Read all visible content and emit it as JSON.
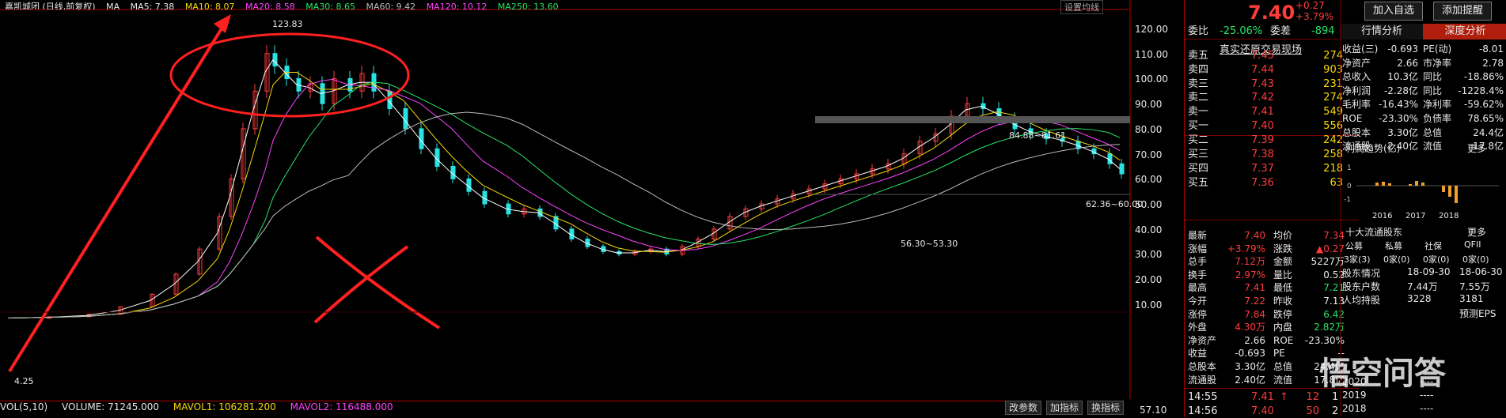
{
  "chart_legend": {
    "title": "嘉凯城团 (日线,前复权)",
    "ma_label": "MA",
    "ma5": "MA5: 7.38",
    "ma10": "MA10: 8.07",
    "ma20": "MA20: 8.58",
    "ma30": "MA30: 8.65",
    "ma60": "MA60: 9.42",
    "ma120": "MA120: 10.12",
    "ma250": "MA250: 13.60"
  },
  "chart_tag": "设置均线",
  "y_axis": [
    "120.00",
    "110.00",
    "100.00",
    "90.00",
    "80.00",
    "70.00",
    "60.00",
    "50.00",
    "40.00",
    "30.00",
    "20.00",
    "10.00"
  ],
  "price_annotations": {
    "high": "123.83",
    "low": "4.25",
    "band1": "84.88~81.61",
    "band2": "62.36~60.00",
    "band3": "56.30~53.30"
  },
  "vol_legend": {
    "vol": "VOL(5,10)",
    "volume": "VOLUME: 71245.000",
    "mavol1": "MAVOL1: 106281.200",
    "mavol2": "MAVOL2: 116488.000"
  },
  "vol_buttons": [
    "改参数",
    "加指标",
    "换指标"
  ],
  "vol_axis": "57.10",
  "quote": {
    "price": "7.40",
    "change": "+0.27",
    "pct": "+3.79%",
    "weibi_label": "委比",
    "weibi": "-25.06%",
    "weicha_label": "委差",
    "weicha": "-894",
    "replay": "真实还原交易现场",
    "asks": [
      {
        "label": "卖五",
        "price": "7.45",
        "vol": "274"
      },
      {
        "label": "卖四",
        "price": "7.44",
        "vol": "903"
      },
      {
        "label": "卖三",
        "price": "7.43",
        "vol": "231"
      },
      {
        "label": "卖二",
        "price": "7.42",
        "vol": "274"
      },
      {
        "label": "卖一",
        "price": "7.41",
        "vol": "549"
      }
    ],
    "bids": [
      {
        "label": "买一",
        "price": "7.40",
        "vol": "556"
      },
      {
        "label": "买二",
        "price": "7.39",
        "vol": "242"
      },
      {
        "label": "买三",
        "price": "7.38",
        "vol": "258"
      },
      {
        "label": "买四",
        "price": "7.37",
        "vol": "218"
      },
      {
        "label": "买五",
        "price": "7.36",
        "vol": "63"
      }
    ],
    "stats": [
      {
        "l1": "最新",
        "v1": "7.40",
        "l2": "均价",
        "v2": "7.34"
      },
      {
        "l1": "涨幅",
        "v1": "+3.79%",
        "l2": "涨跌",
        "v2": "▲0.27"
      },
      {
        "l1": "总手",
        "v1": "7.12万",
        "l2": "金额",
        "v2": "5227万"
      },
      {
        "l1": "换手",
        "v1": "2.97%",
        "l2": "量比",
        "v2": "0.52"
      },
      {
        "l1": "最高",
        "v1": "7.41",
        "l2": "最低",
        "v2": "7.21"
      },
      {
        "l1": "今开",
        "v1": "7.22",
        "l2": "昨收",
        "v2": "7.13"
      },
      {
        "l1": "涨停",
        "v1": "7.84",
        "l2": "跌停",
        "v2": "6.42"
      },
      {
        "l1": "外盘",
        "v1": "4.30万",
        "l2": "内盘",
        "v2": "2.82万"
      },
      {
        "l1": "净资产",
        "v1": "2.66",
        "l2": "ROE",
        "v2": "-23.30%"
      },
      {
        "l1": "收益",
        "v1": "-0.693",
        "l2": "PE",
        "v2": "--"
      },
      {
        "l1": "总股本",
        "v1": "3.30亿",
        "l2": "总值",
        "v2": "24.4亿"
      },
      {
        "l1": "流通股",
        "v1": "2.40亿",
        "l2": "流值",
        "v2": "17.8亿"
      }
    ],
    "ticks": [
      {
        "time": "14:55",
        "price": "7.41",
        "arrow": "↑",
        "vol": "12",
        "flag": "1"
      },
      {
        "time": "14:56",
        "price": "7.40",
        "arrow": "",
        "vol": "50",
        "flag": "2"
      }
    ]
  },
  "f10": {
    "btn_add": "加入自选",
    "btn_alert": "添加提醒",
    "tab_quote": "行情分析",
    "tab_deep": "深度分析",
    "rows": [
      {
        "l1": "收益(三)",
        "v1": "-0.693",
        "l2": "PE(动)",
        "v2": "-8.01"
      },
      {
        "l1": "净资产",
        "v1": "2.66",
        "l2": "市净率",
        "v2": "2.78"
      },
      {
        "l1": "总收入",
        "v1": "10.3亿",
        "l2": "同比",
        "v2": "-18.86%"
      },
      {
        "l1": "净利润",
        "v1": "-2.28亿",
        "l2": "同比",
        "v2": "-1228.4%"
      },
      {
        "l1": "毛利率",
        "v1": "-16.43%",
        "l2": "净利率",
        "v2": "-59.62%"
      },
      {
        "l1": "ROE",
        "v1": "-23.30%",
        "l2": "负债率",
        "v2": "78.65%"
      },
      {
        "l1": "总股本",
        "v1": "3.30亿",
        "l2": "总值",
        "v2": "24.4亿"
      },
      {
        "l1": "流通股",
        "v1": "2.40亿",
        "l2": "流值",
        "v2": "17.8亿"
      }
    ],
    "profit_trend": "利润趋势(亿)",
    "more": "更多",
    "years": [
      "2016",
      "2017",
      "2018"
    ],
    "holders_title": "十大流通股东",
    "holders_more": "更多",
    "holder_cols": [
      "公募",
      "私募",
      "社保",
      "QFII"
    ],
    "holder_counts": [
      "3家(3)",
      "0家(0)",
      "0家(0)",
      "0家(0)"
    ],
    "holder_date_rows": [
      {
        "label": "股东情况",
        "d1": "18-09-30",
        "d2": "18-06-30"
      },
      {
        "label": "股东户数",
        "d1": "7.44万",
        "d2": "7.55万"
      },
      {
        "label": "人均持股",
        "d1": "3228",
        "d2": "3181"
      },
      {
        "label": "",
        "d1": "",
        "d2": "预测EPS"
      }
    ],
    "eps_rows": [
      {
        "year": "2020",
        "v": "----"
      },
      {
        "year": "2019",
        "v": "----"
      },
      {
        "year": "2018",
        "v": "----"
      }
    ]
  },
  "watermark": "悟空问答",
  "colors": {
    "up": "#ff3c3c",
    "down": "#29e3e3",
    "ma5": "#ffffff",
    "ma10": "#f5d90a",
    "ma20": "#ff44ff",
    "ma30": "#29e36a",
    "ma60": "#bbbbbb",
    "annotation": "#ff2020",
    "ellipse_yellow": "#f5e50a"
  }
}
